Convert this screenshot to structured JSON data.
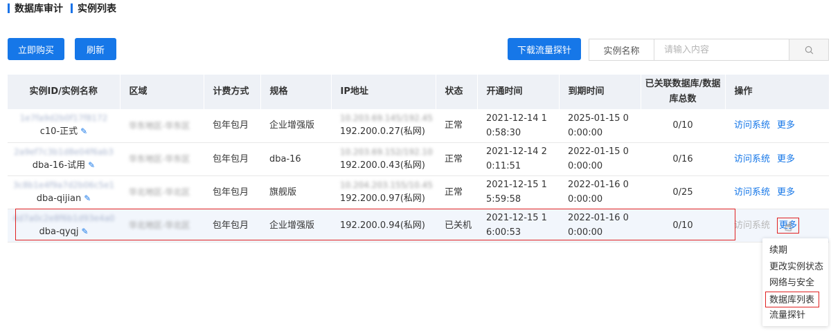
{
  "breadcrumb": [
    "数据库审计",
    "实例列表"
  ],
  "toolbar": {
    "buy_label": "立即购买",
    "refresh_label": "刷新",
    "download_label": "下载流量探针"
  },
  "search": {
    "type_label": "实例名称",
    "placeholder": "请输入内容",
    "icon": "search-icon"
  },
  "table": {
    "headers": [
      "实例ID/实例名称",
      "区域",
      "计费方式",
      "规格",
      "IP地址",
      "状态",
      "开通时间",
      "到期时间",
      "已关联数据库/数据库总数",
      "操作"
    ],
    "rows": [
      {
        "id": "1e7fa9d2b0f17f8172",
        "name": "c10-正式",
        "region": "华东地区-华东区",
        "billing": "包年包月",
        "spec": "企业增强版",
        "ip_public": "10.203.69.145/192.45",
        "ip": "192.200.0.27(私网)",
        "status": "正常",
        "open_time": "2021-12-14 10:58:30",
        "expire_time": "2025-01-15 00:00:00",
        "db_count": "0/10",
        "actions": [
          "访问系统",
          "更多"
        ]
      },
      {
        "id": "2a9ef7c3b1d8e04f6ab3",
        "name": "dba-16-试用",
        "region": "华东地区-华东区",
        "billing": "包年包月",
        "spec": "dba-16",
        "ip_public": "10.203.69.152/192.10",
        "ip": "192.200.0.43(私网)",
        "status": "正常",
        "open_time": "2021-12-14 20:11:51",
        "expire_time": "2022-01-15 00:00:00",
        "db_count": "0/16",
        "actions": [
          "访问系统",
          "更多"
        ]
      },
      {
        "id": "3c8b1e4f9a7d2b06c5e1",
        "name": "dba-qijian",
        "region": "华北地区-华北区",
        "billing": "包年包月",
        "spec": "旗舰版",
        "ip_public": "10.204.203.155/10.45",
        "ip": "192.200.0.97(私网)",
        "status": "正常",
        "open_time": "2021-12-15 15:59:58",
        "expire_time": "2022-01-16 00:00:00",
        "db_count": "0/25",
        "actions": [
          "访问系统",
          "更多"
        ]
      },
      {
        "id": "4d7a0c2e8f6b1d93e4a0",
        "name": "dba-qyqj",
        "region": "华北地区-华北区",
        "billing": "包年包月",
        "spec": "企业增强版",
        "ip": "192.200.0.94(私网)",
        "status": "已关机",
        "open_time": "2021-12-15 16:00:53",
        "expire_time": "2022-01-16 00:00:00",
        "db_count": "0/10",
        "actions": [
          "访问系统",
          "更多"
        ]
      }
    ]
  },
  "dropdown": {
    "items": [
      "续期",
      "更改实例状态",
      "网络与安全",
      "数据库列表",
      "流量探针"
    ],
    "highlighted": "数据库列表"
  },
  "colors": {
    "primary": "#1677e8",
    "highlight": "#e02020",
    "header_bg": "#eef1f6"
  }
}
